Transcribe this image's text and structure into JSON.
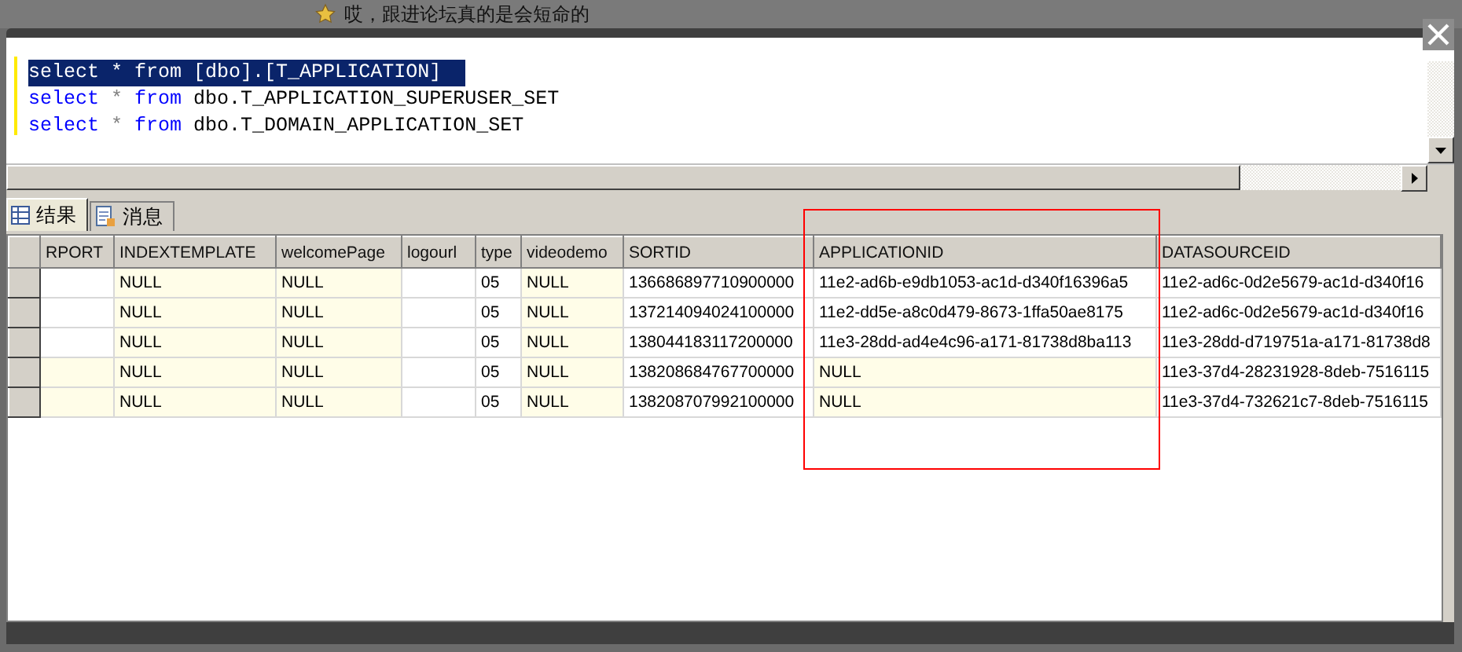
{
  "background_caption": "哎，跟进论坛真的是会短命的",
  "editor": {
    "lines": [
      {
        "selected": true,
        "tokens": [
          {
            "kind": "keyword",
            "text": "select"
          },
          {
            "kind": "operator",
            "text": "*"
          },
          {
            "kind": "keyword",
            "text": "from"
          },
          {
            "kind": "identifier",
            "text": "[dbo].[T_APPLICATION]"
          }
        ]
      },
      {
        "selected": false,
        "tokens": [
          {
            "kind": "keyword",
            "text": "select"
          },
          {
            "kind": "operator",
            "text": "*"
          },
          {
            "kind": "keyword",
            "text": "from"
          },
          {
            "kind": "identifier",
            "text": "dbo.T_APPLICATION_SUPERUSER_SET"
          }
        ]
      },
      {
        "selected": false,
        "tokens": [
          {
            "kind": "keyword",
            "text": "select"
          },
          {
            "kind": "operator",
            "text": "*"
          },
          {
            "kind": "keyword",
            "text": "from"
          },
          {
            "kind": "identifier",
            "text": "dbo.T_DOMAIN_APPLICATION_SET"
          }
        ]
      }
    ]
  },
  "tabs": [
    {
      "label": "结果",
      "kind": "grid",
      "selected": true
    },
    {
      "label": "消息",
      "kind": "messages",
      "selected": false
    }
  ],
  "table": {
    "columns": [
      {
        "label": "RPORT",
        "highlighted": false
      },
      {
        "label": "INDEXTEMPLATE",
        "highlighted": false
      },
      {
        "label": "welcomePage",
        "highlighted": false
      },
      {
        "label": "logourl",
        "highlighted": false
      },
      {
        "label": "type",
        "highlighted": false
      },
      {
        "label": "videodemo",
        "highlighted": false
      },
      {
        "label": "SORTID",
        "highlighted": false
      },
      {
        "label": "APPLICATIONID",
        "highlighted": true
      },
      {
        "label": "DATASOURCEID",
        "highlighted": false
      }
    ],
    "rows": [
      {
        "cells": [
          {
            "null": false
          },
          {
            "text": "NULL",
            "null": true
          },
          {
            "text": "NULL",
            "null": true
          },
          {
            "null": false
          },
          {
            "text": "05",
            "null": false
          },
          {
            "text": "NULL",
            "null": true
          },
          {
            "text": "136686897710900000",
            "null": false
          },
          {
            "text": "11e2-ad6b-e9db1053-ac1d-d340f16396a5",
            "null": false
          },
          {
            "text": "11e2-ad6c-0d2e5679-ac1d-d340f16",
            "null": false
          }
        ]
      },
      {
        "cells": [
          {
            "null": false
          },
          {
            "text": "NULL",
            "null": true
          },
          {
            "text": "NULL",
            "null": true
          },
          {
            "null": false
          },
          {
            "text": "05",
            "null": false
          },
          {
            "text": "NULL",
            "null": true
          },
          {
            "text": "137214094024100000",
            "null": false
          },
          {
            "text": "11e2-dd5e-a8c0d479-8673-1ffa50ae8175",
            "null": false
          },
          {
            "text": "11e2-ad6c-0d2e5679-ac1d-d340f16",
            "null": false
          }
        ]
      },
      {
        "cells": [
          {
            "null": false
          },
          {
            "text": "NULL",
            "null": true
          },
          {
            "text": "NULL",
            "null": true
          },
          {
            "null": false
          },
          {
            "text": "05",
            "null": false
          },
          {
            "text": "NULL",
            "null": true
          },
          {
            "text": "138044183117200000",
            "null": false
          },
          {
            "text": "11e3-28dd-ad4e4c96-a171-81738d8ba113",
            "null": false
          },
          {
            "text": "11e3-28dd-d719751a-a171-81738d8",
            "null": false
          }
        ]
      },
      {
        "cells": [
          {
            "null": true
          },
          {
            "text": "NULL",
            "null": true
          },
          {
            "text": "NULL",
            "null": true
          },
          {
            "null": false
          },
          {
            "text": "05",
            "null": false
          },
          {
            "text": "NULL",
            "null": true
          },
          {
            "text": "138208684767700000",
            "null": false
          },
          {
            "text": "NULL",
            "null": true
          },
          {
            "text": "11e3-37d4-28231928-8deb-7516115",
            "null": false
          }
        ]
      },
      {
        "cells": [
          {
            "null": true
          },
          {
            "text": "NULL",
            "null": true
          },
          {
            "text": "NULL",
            "null": true
          },
          {
            "null": false
          },
          {
            "text": "05",
            "null": false
          },
          {
            "text": "NULL",
            "null": true
          },
          {
            "text": "138208707992100000",
            "null": false
          },
          {
            "text": "NULL",
            "null": true
          },
          {
            "text": "11e3-37d4-732621c7-8deb-7516115",
            "null": false
          }
        ]
      }
    ]
  }
}
